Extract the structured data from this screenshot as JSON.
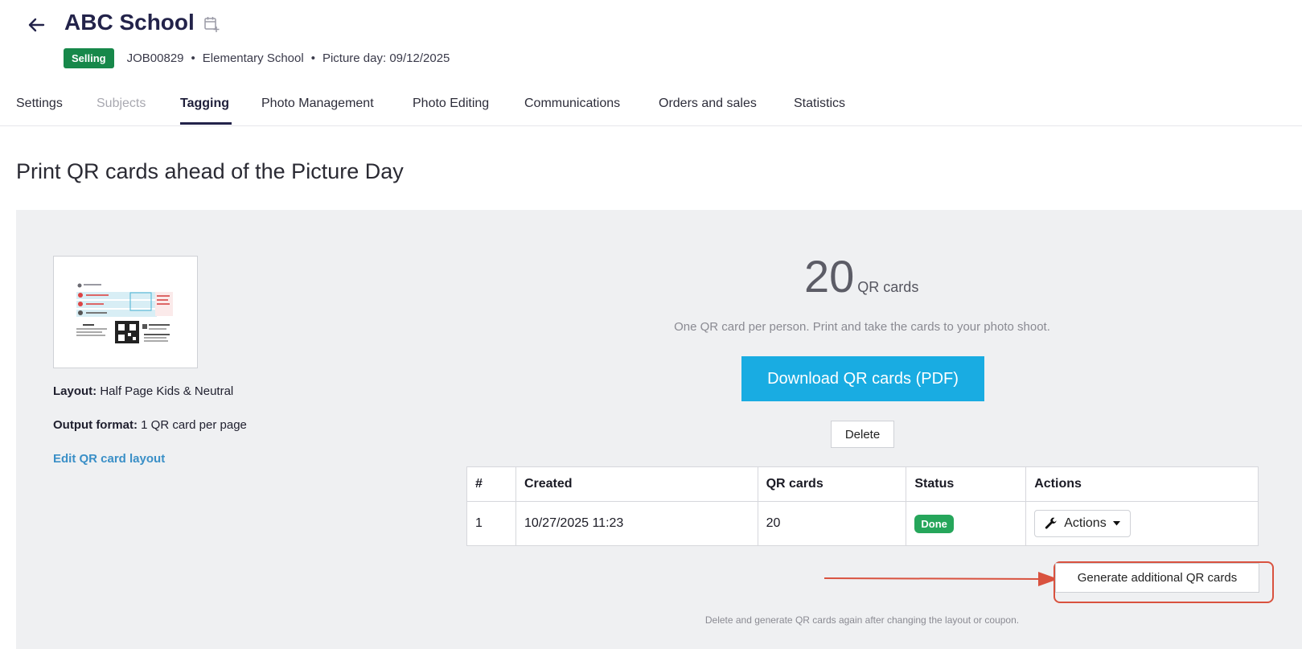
{
  "header": {
    "title": "ABC School",
    "status_badge": "Selling",
    "job_id": "JOB00829",
    "school_type": "Elementary School",
    "picture_day": "Picture day: 09/12/2025",
    "back_icon": "arrow-left-icon",
    "calendar_icon": "calendar-plus-icon"
  },
  "tabs": [
    {
      "label": "Settings",
      "state": "normal"
    },
    {
      "label": "Subjects",
      "state": "disabled"
    },
    {
      "label": "Tagging",
      "state": "active"
    },
    {
      "label": "Photo Management",
      "state": "normal"
    },
    {
      "label": "Photo Editing",
      "state": "normal"
    },
    {
      "label": "Communications",
      "state": "normal"
    },
    {
      "label": "Orders and sales",
      "state": "normal"
    },
    {
      "label": "Statistics",
      "state": "normal"
    }
  ],
  "page_title": "Print QR cards ahead of the Picture Day",
  "layout_info": {
    "layout_label": "Layout:",
    "layout_value": "Half Page Kids & Neutral",
    "output_label": "Output format:",
    "output_value": "1 QR card per page",
    "edit_link": "Edit QR card layout"
  },
  "qr_summary": {
    "count": "20",
    "unit": "QR cards",
    "description": "One QR card per person. Print and take the cards to your photo shoot.",
    "download_label": "Download QR cards (PDF)",
    "delete_label": "Delete"
  },
  "table": {
    "columns": [
      "#",
      "Created",
      "QR cards",
      "Status",
      "Actions"
    ],
    "rows": [
      {
        "num": "1",
        "created": "10/27/2025 11:23",
        "qr_cards": "20",
        "status": "Done",
        "actions_label": "Actions"
      }
    ]
  },
  "generate_label": "Generate additional QR cards",
  "footnote": "Delete and generate QR cards again after changing the layout or coupon.",
  "colors": {
    "brand_dark": "#23234a",
    "selling_green": "#17884a",
    "done_green": "#26a65b",
    "download_blue": "#19ace2",
    "highlight_red": "#d9523f",
    "link_blue": "#3a8fc7"
  }
}
